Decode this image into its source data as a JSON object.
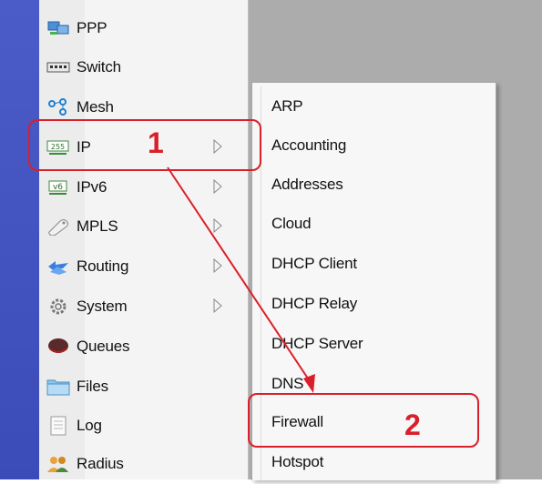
{
  "main_menu": {
    "items": [
      {
        "label": "PPP",
        "icon": "ppp-icon",
        "submenu": false
      },
      {
        "label": "Switch",
        "icon": "switch-icon",
        "submenu": false
      },
      {
        "label": "Mesh",
        "icon": "mesh-icon",
        "submenu": false
      },
      {
        "label": "IP",
        "icon": "ip-icon",
        "icon_text": "255",
        "submenu": true
      },
      {
        "label": "IPv6",
        "icon": "ipv6-icon",
        "icon_text": "v6",
        "submenu": true
      },
      {
        "label": "MPLS",
        "icon": "mpls-icon",
        "submenu": true
      },
      {
        "label": "Routing",
        "icon": "routing-icon",
        "submenu": true
      },
      {
        "label": "System",
        "icon": "system-gear-icon",
        "submenu": true
      },
      {
        "label": "Queues",
        "icon": "queues-icon",
        "submenu": false
      },
      {
        "label": "Files",
        "icon": "folder-icon",
        "submenu": false
      },
      {
        "label": "Log",
        "icon": "log-document-icon",
        "submenu": false
      },
      {
        "label": "Radius",
        "icon": "radius-users-icon",
        "submenu": false
      }
    ]
  },
  "ip_submenu": {
    "items": [
      "ARP",
      "Accounting",
      "Addresses",
      "Cloud",
      "DHCP Client",
      "DHCP Relay",
      "DHCP Server",
      "DNS",
      "Firewall",
      "Hotspot"
    ]
  },
  "annotations": {
    "step1": "1",
    "step2": "2",
    "color": "#d9202a"
  },
  "colors": {
    "side_strip": "#3b4bb8",
    "desktop": "#acacac",
    "menu_bg": "#f4f4f4"
  }
}
